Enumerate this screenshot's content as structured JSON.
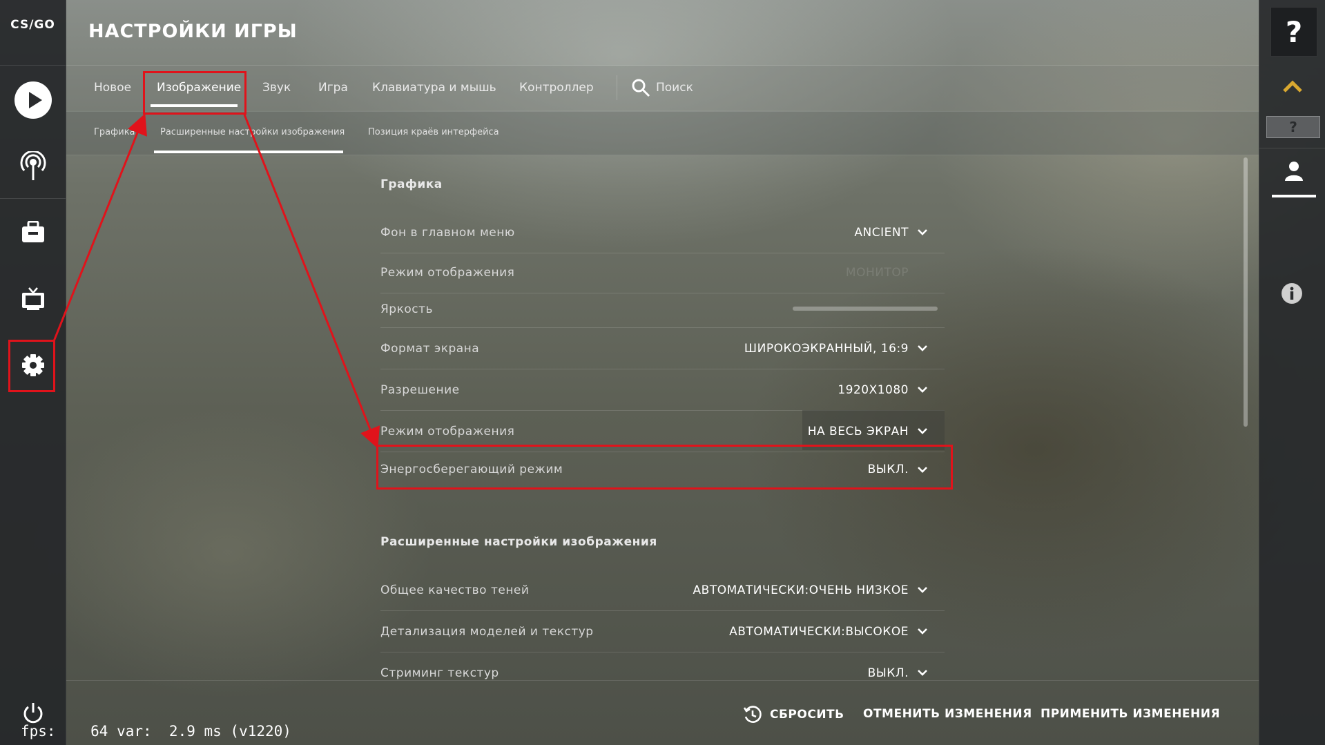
{
  "app": {
    "logo_text": "CS/GO",
    "title": "НАСТРОЙКИ ИГРЫ"
  },
  "tabs": [
    {
      "label": "Новое"
    },
    {
      "label": "Изображение",
      "active": true
    },
    {
      "label": "Звук"
    },
    {
      "label": "Игра"
    },
    {
      "label": "Клавиатура и мышь"
    },
    {
      "label": "Контроллер"
    }
  ],
  "search": {
    "label": "Поиск"
  },
  "subtabs": [
    {
      "label": "Графика"
    },
    {
      "label": "Расширенные настройки изображения",
      "active": true
    },
    {
      "label": "Позиция краёв интерфейса"
    }
  ],
  "sections": {
    "graphics": {
      "title": "Графика",
      "rows": [
        {
          "label": "Фон в главном меню",
          "value": "ANCIENT"
        },
        {
          "label": "Режим отображения",
          "value": "МОНИТОР"
        },
        {
          "label": "Яркость",
          "value": ""
        },
        {
          "label": "Формат экрана",
          "value": "ШИРОКОЭКРАННЫЙ, 16:9"
        },
        {
          "label": "Разрешение",
          "value": "1920X1080"
        },
        {
          "label": "Режим отображения",
          "value": "НА ВЕСЬ ЭКРАН"
        },
        {
          "label": "Энергосберегающий режим",
          "value": "ВЫКЛ."
        }
      ]
    },
    "advanced": {
      "title": "Расширенные настройки изображения",
      "rows": [
        {
          "label": "Общее качество теней",
          "value": "АВТОМАТИЧЕСКИ:ОЧЕНЬ НИЗКОЕ"
        },
        {
          "label": "Детализация моделей и текстур",
          "value": "АВТОМАТИЧЕСКИ:ВЫСОКОЕ"
        },
        {
          "label": "Стриминг текстур",
          "value": "ВЫКЛ."
        }
      ]
    }
  },
  "footer": {
    "reset": "СБРОСИТЬ",
    "discard": "ОТМЕНИТЬ ИЗМЕНЕНИЯ",
    "apply": "ПРИМЕНИТЬ ИЗМЕНЕНИЯ"
  },
  "fps_overlay": "fps:    64 var:  2.9 ms (v1220)",
  "right_bar": {
    "help_label": "?",
    "small_help_label": "?"
  },
  "colors": {
    "annotation_red": "#e0131b",
    "sidebar_bg": "#26282a"
  }
}
